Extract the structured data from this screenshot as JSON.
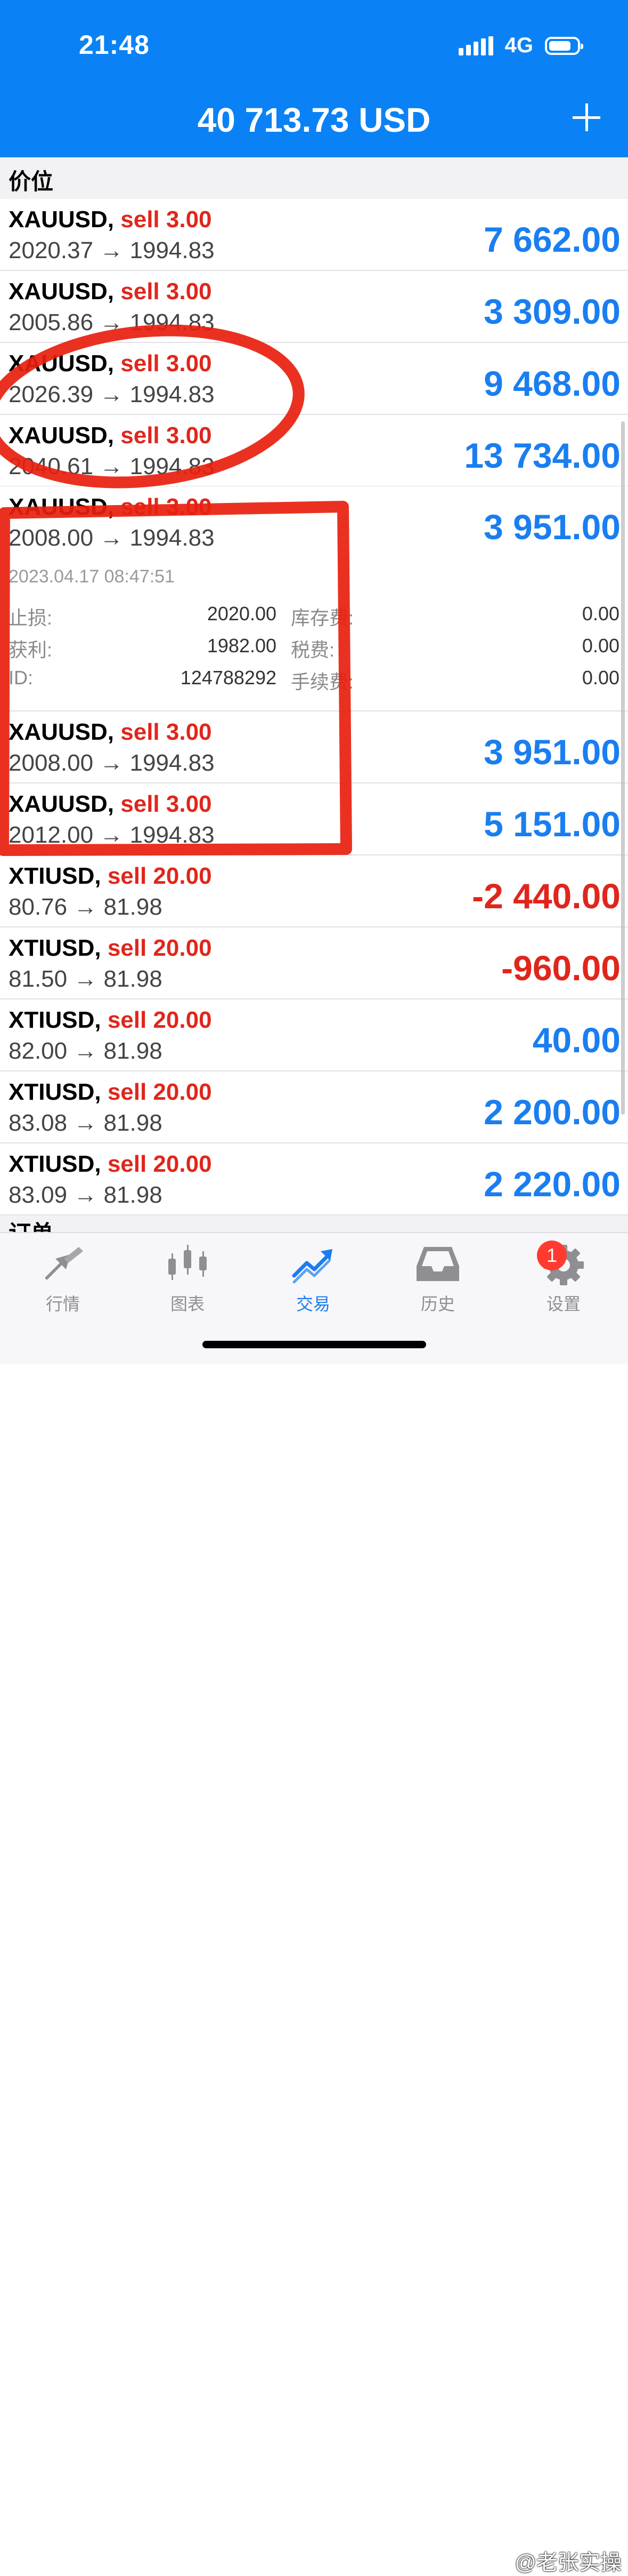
{
  "status_bar": {
    "time": "21:48",
    "network": "4G"
  },
  "header": {
    "balance": "40 713.73 USD"
  },
  "positions_section": {
    "title": "价位"
  },
  "positions": [
    {
      "symbol": "XAUUSD,",
      "side": "sell 3.00",
      "prices": "2020.37 → 1994.83",
      "profit": "7 662.00"
    },
    {
      "symbol": "XAUUSD,",
      "side": "sell 3.00",
      "prices": "2005.86 → 1994.83",
      "profit": "3 309.00"
    },
    {
      "symbol": "XAUUSD,",
      "side": "sell 3.00",
      "prices": "2026.39 → 1994.83",
      "profit": "9 468.00"
    },
    {
      "symbol": "XAUUSD,",
      "side": "sell 3.00",
      "prices": "2040.61 → 1994.83",
      "profit": "13 734.00"
    },
    {
      "symbol": "XAUUSD,",
      "side": "sell 3.00",
      "prices": "2008.00 → 1994.83",
      "profit": "3 951.00"
    },
    {
      "symbol": "XAUUSD,",
      "side": "sell 3.00",
      "prices": "2008.00 → 1994.83",
      "profit": "3 951.00"
    },
    {
      "symbol": "XAUUSD,",
      "side": "sell 3.00",
      "prices": "2012.00 → 1994.83",
      "profit": "5 151.00"
    },
    {
      "symbol": "XTIUSD,",
      "side": "sell 20.00",
      "prices": "80.76 → 81.98",
      "profit": "-2 440.00"
    },
    {
      "symbol": "XTIUSD,",
      "side": "sell 20.00",
      "prices": "81.50 → 81.98",
      "profit": "-960.00"
    },
    {
      "symbol": "XTIUSD,",
      "side": "sell 20.00",
      "prices": "82.00 → 81.98",
      "profit": "40.00"
    },
    {
      "symbol": "XTIUSD,",
      "side": "sell 20.00",
      "prices": "83.08 → 81.98",
      "profit": "2 200.00"
    },
    {
      "symbol": "XTIUSD,",
      "side": "sell 20.00",
      "prices": "83.09 → 81.98",
      "profit": "2 220.00"
    }
  ],
  "expanded_detail": {
    "date": "2023.04.17 08:47:51",
    "stop_loss_label": "止损:",
    "stop_loss": "2020.00",
    "take_profit_label": "获利:",
    "take_profit": "1982.00",
    "id_label": "ID:",
    "id": "124788292",
    "swap_label": "库存费:",
    "swap": "0.00",
    "taxes_label": "税费:",
    "taxes": "0.00",
    "commission_label": "手续费:",
    "commission": "0.00"
  },
  "orders_section": {
    "title": "订单"
  },
  "tabs": [
    {
      "label": "行情",
      "icon": "quotes-arrows-icon"
    },
    {
      "label": "图表",
      "icon": "candlestick-chart-icon"
    },
    {
      "label": "交易",
      "icon": "trade-trend-icon",
      "active": true
    },
    {
      "label": "历史",
      "icon": "history-inbox-icon"
    },
    {
      "label": "设置",
      "icon": "settings-gear-icon",
      "badge": "1"
    }
  ],
  "watermark": "@老张实操",
  "colors": {
    "header_bg": "#0a82f5",
    "profit_positive": "#1a7ef0",
    "profit_negative": "#e0261c",
    "sell": "#e0261c",
    "annotation": "#e8200e"
  }
}
